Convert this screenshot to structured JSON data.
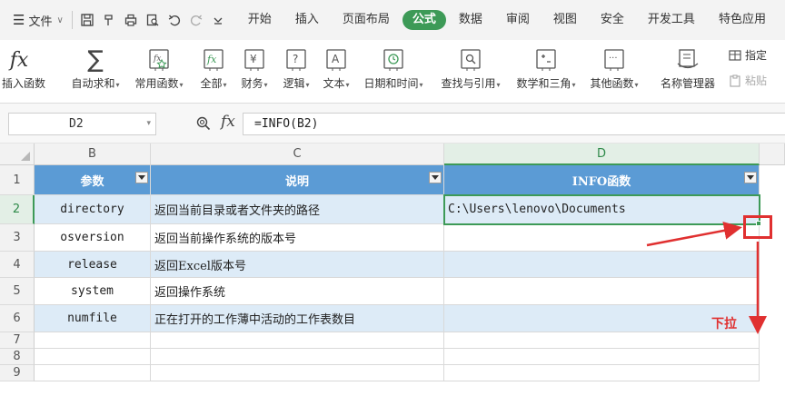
{
  "menubar": {
    "file_label": "文件",
    "tabs": [
      {
        "label": "开始",
        "active": false
      },
      {
        "label": "插入",
        "active": false
      },
      {
        "label": "页面布局",
        "active": false
      },
      {
        "label": "公式",
        "active": true
      },
      {
        "label": "数据",
        "active": false
      },
      {
        "label": "审阅",
        "active": false
      },
      {
        "label": "视图",
        "active": false
      },
      {
        "label": "安全",
        "active": false
      },
      {
        "label": "开发工具",
        "active": false
      },
      {
        "label": "特色应用",
        "active": false
      }
    ],
    "active_color": "#3d9a57"
  },
  "ribbon": {
    "buttons": [
      {
        "label": "插入函数",
        "icon": "fx-icon",
        "dropdown": false
      },
      {
        "label": "自动求和",
        "icon": "sigma-icon",
        "dropdown": true
      },
      {
        "label": "常用函数",
        "icon": "star-function-icon",
        "dropdown": true
      },
      {
        "label": "全部",
        "icon": "all-functions-icon",
        "dropdown": true
      },
      {
        "label": "财务",
        "icon": "finance-icon",
        "dropdown": true
      },
      {
        "label": "逻辑",
        "icon": "logic-icon",
        "dropdown": true
      },
      {
        "label": "文本",
        "icon": "text-icon",
        "dropdown": true
      },
      {
        "label": "日期和时间",
        "icon": "clock-icon",
        "dropdown": true
      },
      {
        "label": "查找与引用",
        "icon": "lookup-icon",
        "dropdown": true
      },
      {
        "label": "数学和三角",
        "icon": "math-icon",
        "dropdown": true
      },
      {
        "label": "其他函数",
        "icon": "more-functions-icon",
        "dropdown": true
      },
      {
        "label": "名称管理器",
        "icon": "name-manager-icon",
        "dropdown": false
      }
    ],
    "define_label": "指定",
    "paste_label": "粘贴"
  },
  "formula_bar": {
    "name_box": "D2",
    "formula": "=INFO(B2)",
    "fx_label": "fx"
  },
  "sheet": {
    "columns": [
      "B",
      "C",
      "D"
    ],
    "rows": [
      "1",
      "2",
      "3",
      "4",
      "5",
      "6",
      "7",
      "8",
      "9"
    ],
    "header": [
      "参数",
      "说明",
      "INFO函数"
    ],
    "data": [
      {
        "param": "directory",
        "desc": "返回当前目录或者文件夹的路径",
        "result": "C:\\Users\\lenovo\\Documents"
      },
      {
        "param": "osversion",
        "desc": "返回当前操作系统的版本号",
        "result": ""
      },
      {
        "param": "release",
        "desc": "返回Excel版本号",
        "result": ""
      },
      {
        "param": "system",
        "desc": "返回操作系统",
        "result": ""
      },
      {
        "param": "numfile",
        "desc": "正在打开的工作薄中活动的工作表数目",
        "result": ""
      }
    ],
    "header_color": "#5b9bd5",
    "band_color": "#ddebf7",
    "active_cell": "D2"
  },
  "annotation": {
    "text": "下拉",
    "color": "#e03030"
  }
}
